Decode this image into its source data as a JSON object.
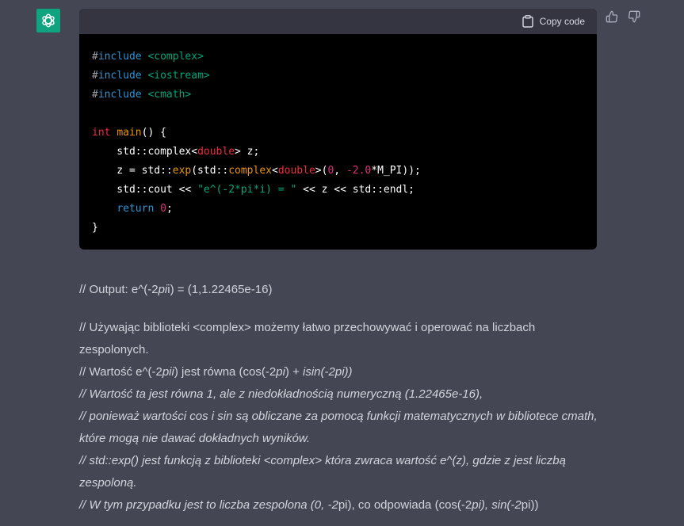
{
  "copy_label": "Copy code",
  "code": {
    "include1_kw": "include",
    "include1_hdr": "<complex>",
    "include2_kw": "include",
    "include2_hdr": "<iostream>",
    "include3_kw": "include",
    "include3_hdr": "<cmath>",
    "main_type": "int",
    "main_name": "main",
    "main_rest": "() {",
    "l1_a": "    std::complex<",
    "l1_type": "double",
    "l1_b": "> z;",
    "l2_a": "    z = std::",
    "l2_fn": "exp",
    "l2_b": "(std::",
    "l2_fn2": "complex",
    "l2_c": "<",
    "l2_type": "double",
    "l2_d": ">(",
    "l2_num1": "0",
    "l2_e": ", ",
    "l2_num2": "-2.0",
    "l2_f": "*M_PI));",
    "l3_a": "    std::cout << ",
    "l3_str": "\"e^(-2*pi*i) = \"",
    "l3_b": " << z << std::endl;",
    "l4_ws": "    ",
    "l4_kw": "return",
    "l4_sp": " ",
    "l4_num": "0",
    "l4_end": ";",
    "close": "}"
  },
  "prose": {
    "p1_a": "// Output: e^(-2",
    "p1_b": "pi",
    "p1_c": "i) = (1,1.22465e-16)",
    "p2_a": "// Używając biblioteki <complex> możemy łatwo przechowywać i operować na liczbach zespolonych.",
    "p2_b1": "// Wartość e^(-2",
    "p2_b2": "pii",
    "p2_b3": ") jest równa (cos(-2",
    "p2_b4": "pi",
    "p2_b5": ") + ",
    "p2_b6": "isin(-2pi))",
    "p2_c": "// Wartość ta jest równa 1, ale z niedokładnością numeryczną (1.22465e-16),",
    "p2_d": "// ponieważ wartości cos i sin są obliczane za pomocą funkcji matematycznych w bibliotece cmath, które mogą nie dawać dokładnych wyników.",
    "p2_e": "// std::exp() jest funkcją z biblioteki <complex> która zwraca wartość e^(z), gdzie z jest liczbą zespoloną.",
    "p2_f1": "// W tym przypadku jest to liczba zespolona (0, -2",
    "p2_f2": "pi",
    "p2_f3": "), co odpowiada (cos(-2",
    "p2_f4": "pi), sin(-2",
    "p2_f5": "pi",
    "p2_f6": "))"
  },
  "colors": {
    "background": "#444654",
    "code_bg": "#000000",
    "code_header_bg": "#343541",
    "avatar": "#10a37f"
  },
  "icons": {
    "avatar": "openai-logo-icon",
    "copy": "clipboard-icon",
    "like": "thumbs-up-icon",
    "dislike": "thumbs-down-icon"
  }
}
